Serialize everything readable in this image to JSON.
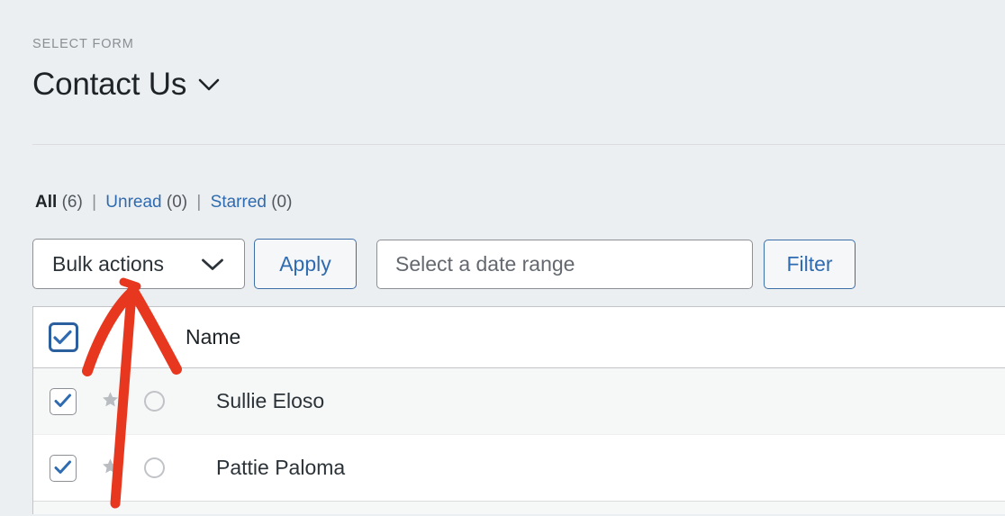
{
  "page": {
    "background_color": "#eceff1",
    "accent_blue": "#2f6bb0"
  },
  "form_selector": {
    "label": "SELECT FORM",
    "selected_form": "Contact Us",
    "chevron_icon": "chevron-down-icon"
  },
  "filter_links": {
    "all": {
      "label": "All",
      "count": "(6)"
    },
    "unread": {
      "label": "Unread",
      "count": "(0)"
    },
    "starred": {
      "label": "Starred",
      "count": "(0)"
    },
    "separator": "|"
  },
  "toolbar": {
    "bulk_actions": {
      "selected": "Bulk actions",
      "chevron_icon": "chevron-down-icon"
    },
    "apply_label": "Apply",
    "date_range": {
      "value": "",
      "placeholder": "Select a date range"
    },
    "filter_label": "Filter"
  },
  "table": {
    "header": {
      "select_all_checked": true,
      "name_column": "Name"
    },
    "rows": [
      {
        "checked": true,
        "starred": false,
        "read_marker": "unread-circle-icon",
        "name": "Sullie Eloso",
        "striped": true
      },
      {
        "checked": true,
        "starred": false,
        "read_marker": "unread-circle-icon",
        "name": "Pattie Paloma",
        "striped": false
      }
    ]
  },
  "annotation": {
    "type": "hand-drawn-arrow",
    "color": "#e8371f",
    "direction": "up",
    "points_at": "bulk-actions-select"
  }
}
